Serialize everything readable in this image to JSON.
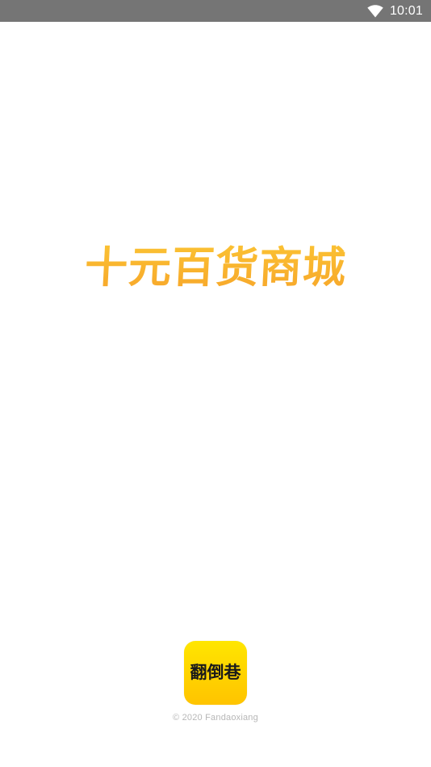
{
  "status_bar": {
    "time": "10:01",
    "icons": [
      "wifi-icon"
    ]
  },
  "splash": {
    "title": "十元百货商城",
    "title_color": "#F8B52A"
  },
  "app_logo": {
    "text": "翻倒巷",
    "background_color": "#FFD800"
  },
  "footer": {
    "copyright": "© 2020 Fandaoxiang"
  }
}
